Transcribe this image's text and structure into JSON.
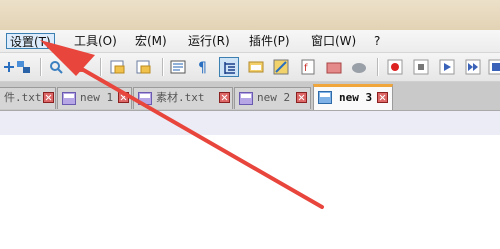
{
  "menubar": {
    "items": [
      {
        "label": "设置(T)",
        "active": true
      },
      {
        "label": "工具(O)"
      },
      {
        "label": "宏(M)"
      },
      {
        "label": "运行(R)"
      },
      {
        "label": "插件(P)"
      },
      {
        "label": "窗口(W)"
      },
      {
        "label": "?"
      }
    ]
  },
  "toolbar": {
    "buttons": [
      "zoom-in-icon",
      "wrap-icon",
      "find-icon",
      "replace-icon",
      "open-icon",
      "save-icon",
      "show-all-icon",
      "paragraph-icon",
      "indent-guide-icon",
      "folder-icon",
      "map-icon",
      "function-list-icon",
      "folder-workspace-icon",
      "cloud-icon",
      "record-macro-icon",
      "stop-record-icon",
      "play-macro-icon",
      "run-multiple-icon",
      "save-macro-icon"
    ]
  },
  "tabs": [
    {
      "label": "件.txt"
    },
    {
      "label": "new 1"
    },
    {
      "label": "素材.txt"
    },
    {
      "label": "new 2"
    },
    {
      "label": "new 3",
      "active": true
    }
  ],
  "annotation": {
    "color": "#e8453c"
  }
}
